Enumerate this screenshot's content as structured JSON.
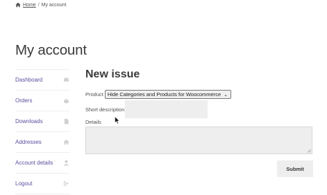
{
  "breadcrumb": {
    "home": "Home",
    "separator": "/",
    "current": "My account"
  },
  "page": {
    "title": "My account"
  },
  "nav": {
    "items": [
      {
        "label": "Dashboard",
        "icon": "dashboard-icon"
      },
      {
        "label": "Orders",
        "icon": "basket-icon"
      },
      {
        "label": "Downloads",
        "icon": "file-icon"
      },
      {
        "label": "Addresses",
        "icon": "home-icon"
      },
      {
        "label": "Account details",
        "icon": "user-icon"
      },
      {
        "label": "Logout",
        "icon": "logout-icon"
      }
    ]
  },
  "form": {
    "title": "New issue",
    "product_label": "Product",
    "product_value": "Hide Categories and Products for Woocommerce",
    "short_description_label": "Short description",
    "short_description_value": "",
    "details_label": "Details",
    "details_value": "",
    "submit_label": "Submit"
  }
}
